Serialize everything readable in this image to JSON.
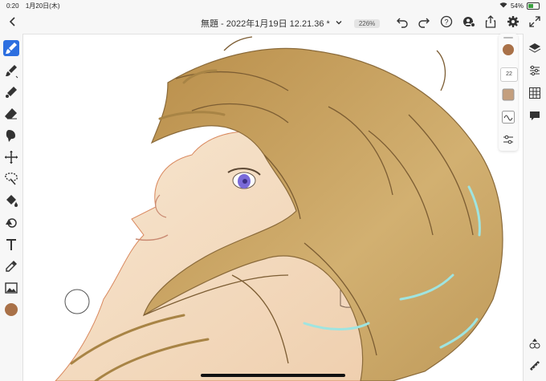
{
  "status": {
    "time": "0:20",
    "date": "1月20日(木)",
    "battery": "54%",
    "battery_level": 0.54
  },
  "document": {
    "title": "無題 - 2022年1月19日 12.21.36 *",
    "zoom": "226%"
  },
  "brush": {
    "size": "22",
    "color": "#a97148"
  },
  "colors": {
    "accent": "#2d6fe0",
    "hair": "#c9a35c",
    "skin": "#f3dcc4",
    "eye": "#7a6ad8"
  },
  "icons": {
    "top": [
      "back-icon",
      "chevron-down-icon",
      "undo-icon",
      "redo-icon",
      "help-icon",
      "share-user-icon",
      "export-icon",
      "settings-icon",
      "fullscreen-icon"
    ],
    "left": [
      "pixel-brush-icon",
      "live-brush-icon",
      "vector-brush-icon",
      "eraser-icon",
      "smudge-icon",
      "transform-icon",
      "selection-icon",
      "fill-icon",
      "shape-icon",
      "text-icon",
      "eyedropper-icon",
      "image-icon",
      "color-swatch-icon"
    ],
    "right": [
      "layers-icon",
      "layer-properties-icon",
      "grid-icon",
      "comments-icon",
      "brush-settings-icon",
      "measure-icon"
    ]
  }
}
